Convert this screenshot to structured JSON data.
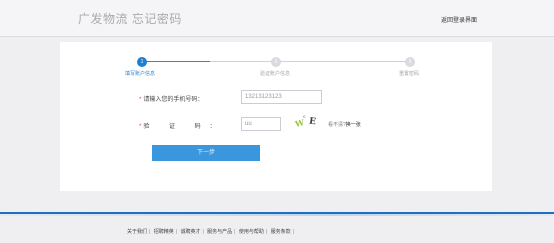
{
  "header": {
    "brand": "广发物流 忘记密码",
    "home_link": "返回登录界面"
  },
  "steps": [
    {
      "number": "1",
      "label": "填写账户信息",
      "active": true
    },
    {
      "number": "2",
      "label": "验证账户信息",
      "active": false
    },
    {
      "number": "3",
      "label": "重置密码",
      "active": false
    }
  ],
  "form": {
    "phone": {
      "required_mark": "*",
      "label": "请输入您的手机号码：",
      "value": "13213123123"
    },
    "captcha": {
      "required_mark": "*",
      "label": "验  证  码：",
      "value": "uu",
      "image_text": "WcE",
      "hint": "看不清?",
      "refresh_label": "换一张"
    },
    "next_label": "下一步"
  },
  "footer": {
    "links": [
      "关于我们",
      "招聘精英",
      "诚聘英才",
      "服务与产品",
      "使用与帮助",
      "服务条款"
    ]
  },
  "colors": {
    "accent": "#1f7fd0",
    "button": "#3a97dd",
    "required": "#e04a3a"
  }
}
